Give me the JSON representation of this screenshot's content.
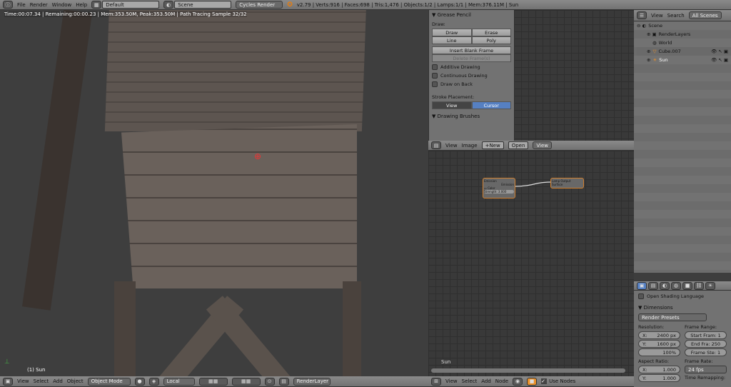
{
  "topbar": {
    "menus": [
      "File",
      "Render",
      "Window",
      "Help"
    ],
    "layout": "Default",
    "scene": "Scene",
    "engine": "Cycles Render",
    "stats": "v2.79 | Verts:916 | Faces:698 | Tris:1,476 | Objects:1/2 | Lamps:1/1 | Mem:376.11M | Sun"
  },
  "viewport": {
    "render_info": "Time:00:07.34 | Remaining:00:00.23 | Mem:353.50M, Peak:353.50M | Path Tracing Sample 32/32",
    "object_label": "(1) Sun"
  },
  "viewport_header": {
    "menus": [
      "View",
      "Select",
      "Add",
      "Object"
    ],
    "mode": "Object Mode",
    "pivot": "Local",
    "render_layer": "RenderLayer"
  },
  "grease_pencil": {
    "title": "Grease Pencil",
    "draw_label": "Draw:",
    "draw": "Draw",
    "erase": "Erase",
    "line": "Line",
    "poly": "Poly",
    "insert": "Insert Blank Frame",
    "delete": "Delete Frame(s)",
    "options": [
      "Additive Drawing",
      "Continuous Drawing",
      "Draw on Back"
    ],
    "stroke_label": "Stroke Placement:",
    "stroke_view": "View",
    "stroke_cursor": "Cursor",
    "brushes": "Drawing Brushes"
  },
  "image_header": {
    "menus": [
      "View",
      "Image"
    ],
    "new": "New",
    "open": "Open",
    "view": "View"
  },
  "outliner": {
    "view": "View",
    "search": "Search",
    "all_scenes": "All Scenes",
    "items": [
      "Scene",
      "RenderLayers",
      "World",
      "Cube.007",
      "Sun"
    ]
  },
  "nodes": {
    "emission": "Emission",
    "emission_out": "Emission",
    "color": "Color",
    "strength": "Strength: 3.000",
    "lamp_output": "Lamp Output",
    "surface": "Surface",
    "label": "Sun"
  },
  "node_header": {
    "menus": [
      "View",
      "Select",
      "Add",
      "Node"
    ],
    "use_nodes": "Use Nodes"
  },
  "properties": {
    "osl": "Open Shading Language",
    "dimensions": "Dimensions",
    "presets": "Render Presets",
    "resolution": "Resolution:",
    "res_x_label": "X:",
    "res_x": "2400 px",
    "res_y_label": "Y:",
    "res_y": "1600 px",
    "res_pct": "100%",
    "frame_range": "Frame Range:",
    "start": "Start Fram: 1",
    "end": "End Fra: 250",
    "step": "Frame Ste: 1",
    "aspect": "Aspect Ratio:",
    "asp_x_label": "X:",
    "asp_x": "1.000",
    "asp_y_label": "Y:",
    "asp_y": "1.000",
    "frame_rate": "Frame Rate:",
    "fps": "24 fps",
    "time_remap": "Time Remapping:"
  }
}
